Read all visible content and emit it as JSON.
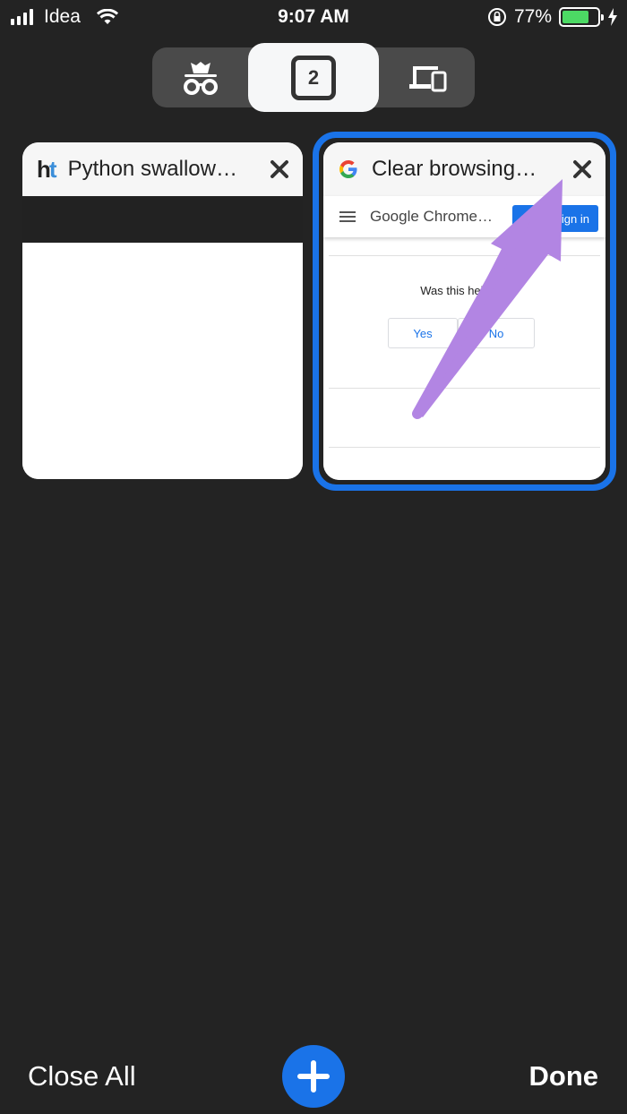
{
  "status_bar": {
    "carrier": "Idea",
    "time": "9:07 AM",
    "battery_percent": "77%",
    "battery_level": 0.77,
    "battery_color": "#4cd964"
  },
  "tab_switcher": {
    "segments": {
      "incognito_icon": "incognito-icon",
      "open_tab_count": "2",
      "devices_icon": "devices-icon"
    }
  },
  "tabs": [
    {
      "favicon": "ht-logo",
      "favicon_text_h": "h",
      "favicon_text_t": "t",
      "title": "Python swallow…",
      "selected": false
    },
    {
      "favicon": "google-g-icon",
      "title": "Clear browsing…",
      "selected": true,
      "preview": {
        "header_title": "Google Chrome…",
        "signin_label": "Sign in",
        "question": "Was this helpful?",
        "yes_label": "Yes",
        "no_label": "No"
      }
    }
  ],
  "toolbar": {
    "close_all_label": "Close All",
    "done_label": "Done"
  },
  "colors": {
    "background": "#232323",
    "accent": "#1a73e8",
    "annotation_arrow": "#b285e3"
  }
}
